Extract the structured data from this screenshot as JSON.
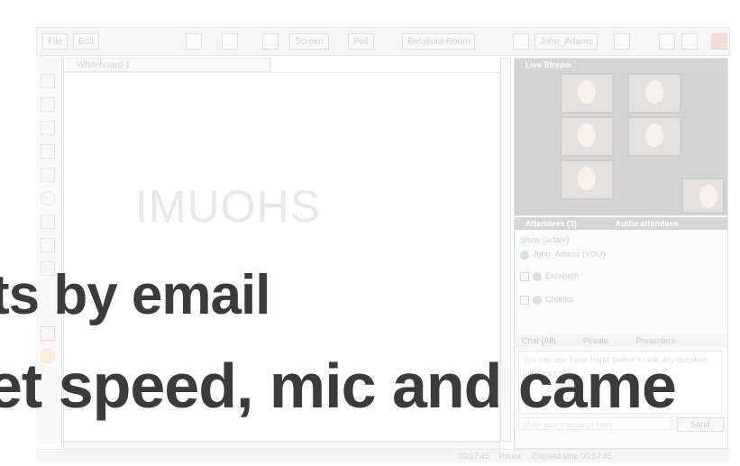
{
  "toolbar": {
    "file_label": "File",
    "edit_label": "Edit",
    "screen_label": "Screen",
    "poll_label": "Poll",
    "breakout_label": "Breakout Room",
    "user_label": "John_Adams"
  },
  "whiteboard": {
    "tab_label": "Whiteboard 1",
    "canvas_text": "IMUOHS"
  },
  "panel": {
    "video_title": "Live Stream",
    "attendees_title": "Attendees (3)",
    "audio_attendees_label": "Audio attendees",
    "show_label": "Show (active)",
    "attendees": [
      {
        "name": "John_Adams (YOU)"
      },
      {
        "name": "Elizabeth"
      },
      {
        "name": "Charles"
      }
    ],
    "chat_tabs": [
      "Chat (All)",
      "Private",
      "Presenters"
    ],
    "chat_hint": "You can use 'raise hand' button to ask any question.",
    "chat_time": "[05:14:43:00]",
    "message_placeholder": "Write your message here",
    "send_label": "Send"
  },
  "status": {
    "elapsed": "00:57:45",
    "pause_label": "Pause",
    "elapsed_label": "Elapsed time 00:57:45"
  },
  "headline": {
    "line1": "ts by email",
    "line2": "et speed, mic and came"
  }
}
